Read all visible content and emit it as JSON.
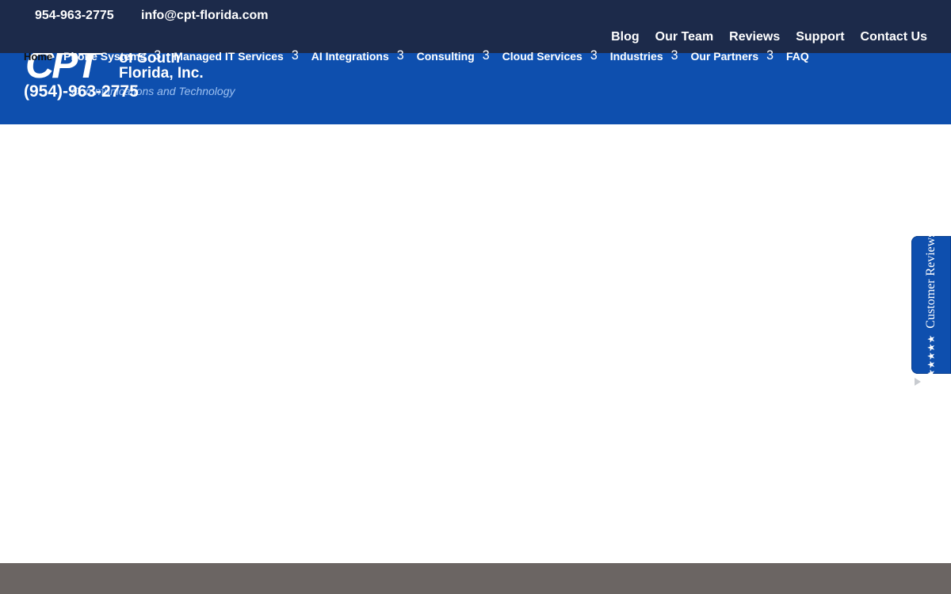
{
  "topbar": {
    "phone": "954-963-2775",
    "email": "info@cpt-florida.com"
  },
  "secondary_nav": [
    {
      "label": "Blog"
    },
    {
      "label": "Our Team"
    },
    {
      "label": "Reviews"
    },
    {
      "label": "Support"
    },
    {
      "label": "Contact Us"
    }
  ],
  "logo": {
    "mark": "CPT",
    "line1": "of South",
    "line2": "Florida, Inc.",
    "tagline": "Communications and Technology"
  },
  "header": {
    "phone": "(954)-963-2775"
  },
  "main_nav": {
    "home": "Home",
    "items": [
      {
        "label": "Phone Systems",
        "chevron": "3"
      },
      {
        "label": "Managed IT Services",
        "chevron": "3"
      },
      {
        "label": "AI Integrations",
        "chevron": "3"
      },
      {
        "label": "Consulting",
        "chevron": "3"
      },
      {
        "label": "Cloud Services",
        "chevron": "3"
      },
      {
        "label": "Industries",
        "chevron": "3"
      },
      {
        "label": "Our Partners",
        "chevron": "3"
      }
    ],
    "faq": "FAQ"
  },
  "reviews_tab": {
    "stars": "★★★★★",
    "label": "Customer Reviews"
  },
  "colors": {
    "topbar": "#1c2a4a",
    "header": "#0e4fae",
    "footer": "#6b6563"
  }
}
